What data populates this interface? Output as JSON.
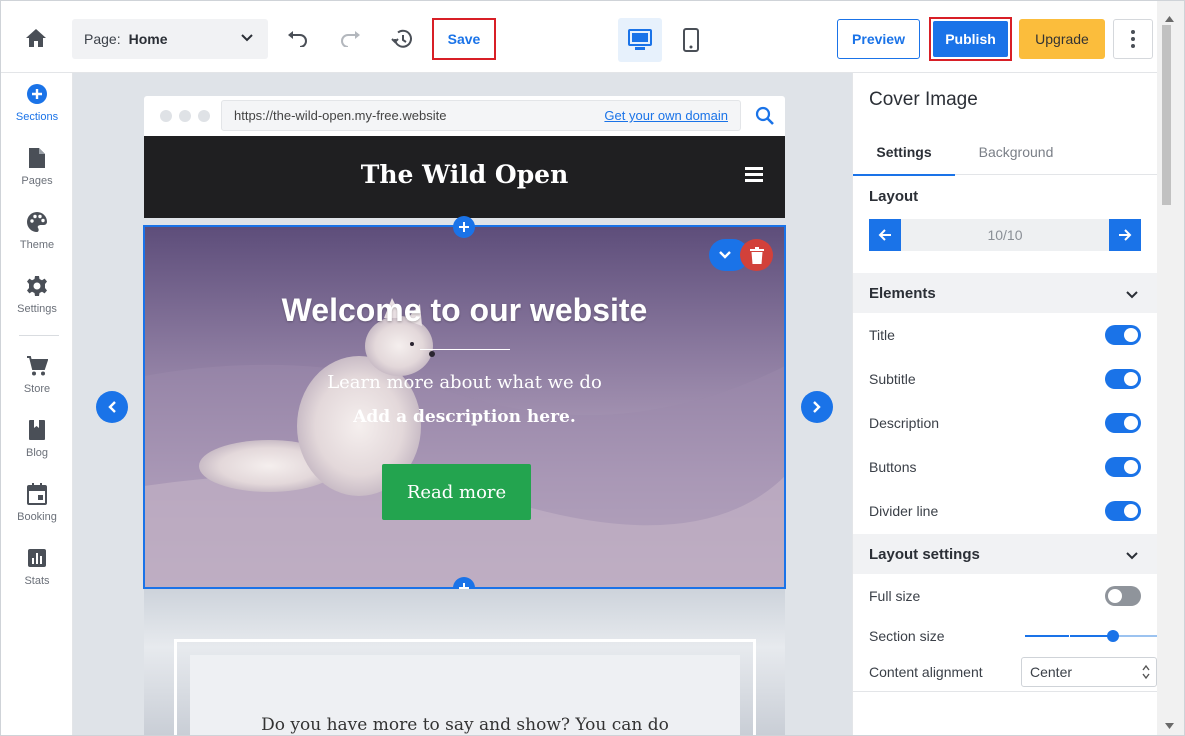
{
  "topbar": {
    "page_label": "Page:",
    "page_value": "Home",
    "save": "Save",
    "preview": "Preview",
    "publish": "Publish",
    "upgrade": "Upgrade"
  },
  "sidebar": {
    "items": [
      {
        "label": "Sections",
        "icon": "plus-circle-icon",
        "active": true
      },
      {
        "label": "Pages",
        "icon": "page-icon"
      },
      {
        "label": "Theme",
        "icon": "palette-icon"
      },
      {
        "label": "Settings",
        "icon": "gear-icon"
      },
      {
        "label": "Store",
        "icon": "cart-icon"
      },
      {
        "label": "Blog",
        "icon": "book-icon"
      },
      {
        "label": "Booking",
        "icon": "calendar-icon"
      },
      {
        "label": "Stats",
        "icon": "bar-chart-icon"
      }
    ]
  },
  "browser": {
    "url": "https://the-wild-open.my-free.website",
    "domain_link": "Get your own domain"
  },
  "site": {
    "title": "The Wild Open",
    "cover": {
      "title": "Welcome to our website",
      "subtitle": "Learn more about what we do",
      "description": "Add a description here.",
      "button": "Read more"
    },
    "next_text": "Do you have more to say and show? You can do"
  },
  "panel": {
    "title": "Cover Image",
    "tabs": [
      "Settings",
      "Background"
    ],
    "layout_label": "Layout",
    "layout_value": "10/10",
    "elements_header": "Elements",
    "elements": [
      {
        "label": "Title",
        "on": true
      },
      {
        "label": "Subtitle",
        "on": true
      },
      {
        "label": "Description",
        "on": true
      },
      {
        "label": "Buttons",
        "on": true
      },
      {
        "label": "Divider line",
        "on": true
      }
    ],
    "layout_settings_header": "Layout settings",
    "full_size_label": "Full size",
    "full_size_on": false,
    "section_size_label": "Section size",
    "section_size_level": 0.66,
    "content_alignment_label": "Content alignment",
    "content_alignment_value": "Center"
  },
  "colors": {
    "accent": "#1a73e8",
    "upgrade": "#fbbd3c",
    "highlight_border": "#d81f26",
    "cta_green": "#23a44f"
  }
}
